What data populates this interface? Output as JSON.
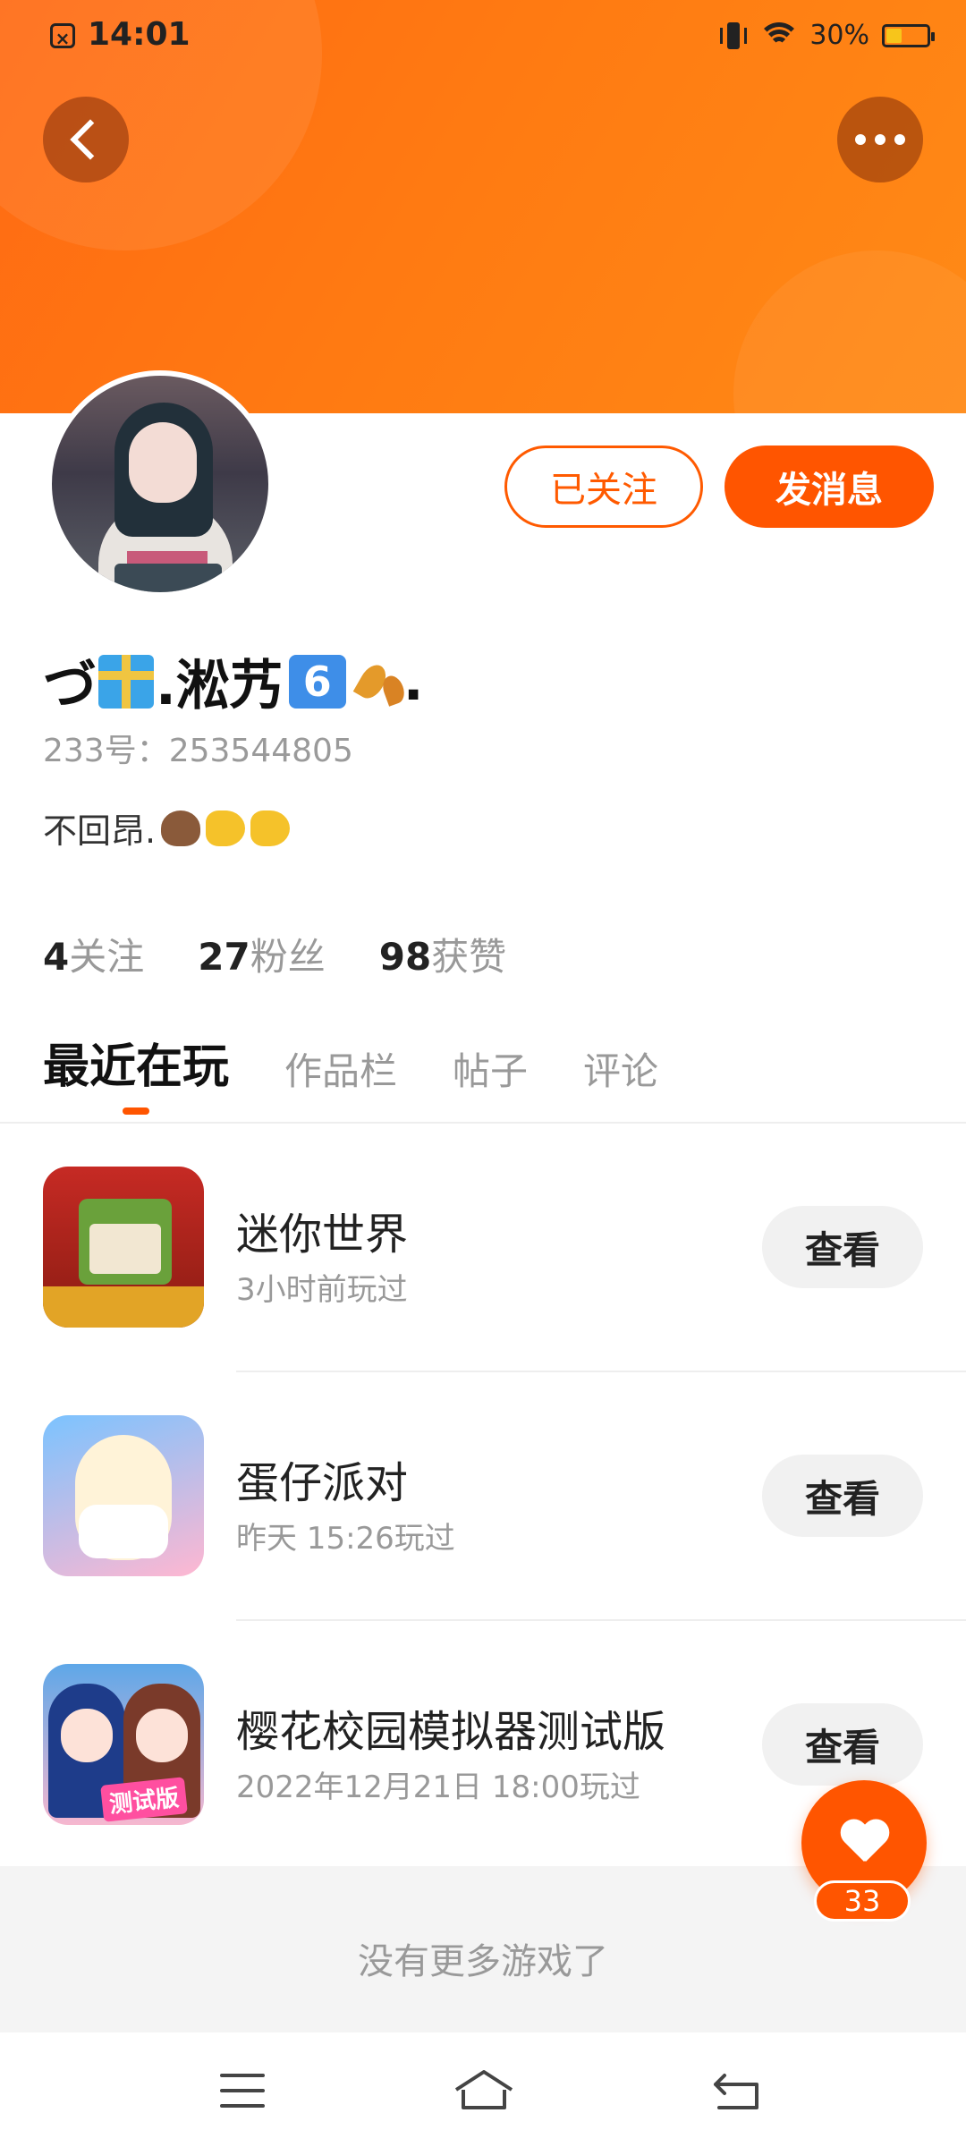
{
  "status_bar": {
    "time": "14:01",
    "battery_text": "30%"
  },
  "header": {
    "back_icon": "chevron-left-icon",
    "more_icon": "more-dots-icon",
    "header_color": "#ff6a13"
  },
  "profile": {
    "nickname_prefix": "づ",
    "nickname_middle": ".淞艿",
    "nickname_badge": "6",
    "nickname_suffix": ".",
    "uid": "233号：253544805",
    "bio": "不回昂.",
    "follow_button": "已关注",
    "message_button": "发消息"
  },
  "stats": [
    {
      "num": "4",
      "label": "关注"
    },
    {
      "num": "27",
      "label": "粉丝"
    },
    {
      "num": "98",
      "label": "获赞"
    }
  ],
  "tabs": [
    "最近在玩",
    "作品栏",
    "帖子",
    "评论"
  ],
  "games": [
    {
      "name": "迷你世界",
      "time": "3小时前玩过",
      "button": "查看"
    },
    {
      "name": "蛋仔派对",
      "time": "昨天 15:26玩过",
      "button": "查看"
    },
    {
      "name": "樱花校园模拟器测试版",
      "time": "2022年12月21日 18:00玩过",
      "button": "查看",
      "icon_badge": "测试版"
    }
  ],
  "footer_text": "没有更多游戏了",
  "like": {
    "count": "33"
  },
  "accent_color": "#ff5500"
}
